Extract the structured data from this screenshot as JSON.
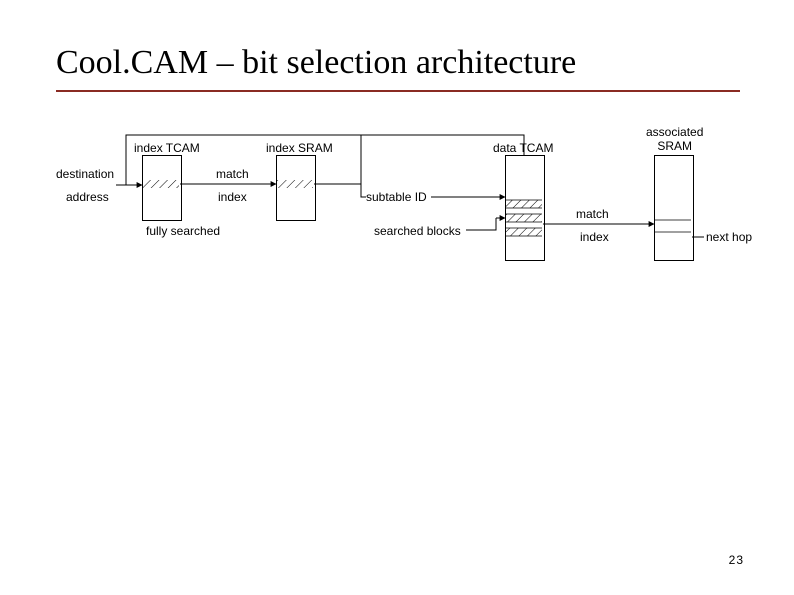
{
  "slide": {
    "title": "Cool.CAM – bit selection architecture",
    "page_number": "23"
  },
  "diagram": {
    "labels": {
      "destination": "destination",
      "address": "address",
      "index_tcam": "index TCAM",
      "index_sram": "index SRAM",
      "data_tcam": "data TCAM",
      "associated_sram": "associated\nSRAM",
      "match1": "match",
      "index1": "index",
      "fully_searched": "fully searched",
      "subtable_id": "subtable ID",
      "searched_blocks": "searched blocks",
      "match2": "match",
      "index2": "index",
      "next_hop": "next hop"
    }
  }
}
